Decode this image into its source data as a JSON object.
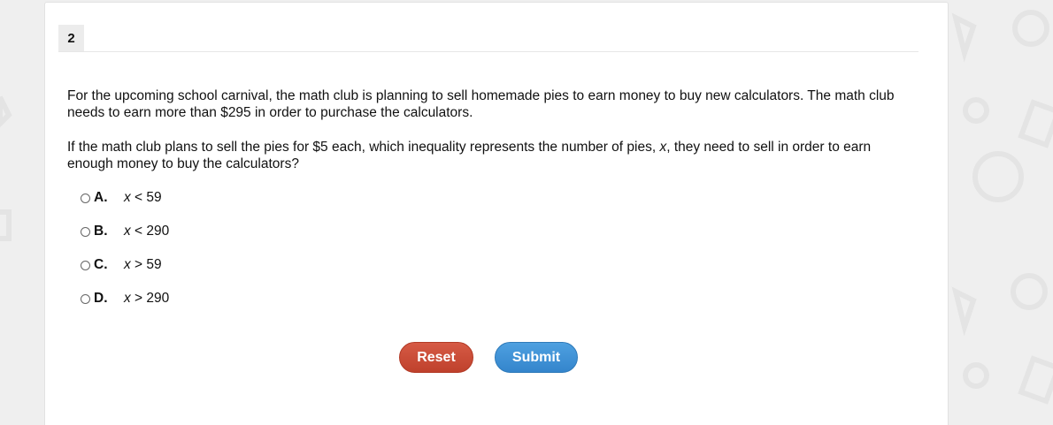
{
  "question": {
    "number": "2",
    "paragraph1": "For the upcoming school carnival, the math club is planning to sell homemade pies to earn money to buy new calculators. The math club needs to earn more than $295 in order to purchase the calculators.",
    "paragraph2_part1": "If the math club plans to sell the pies for $5 each, which inequality represents the number of pies, ",
    "paragraph2_var": "x",
    "paragraph2_part2": ", they need to sell in order to earn enough money to buy the calculators?",
    "options": [
      {
        "letter": "A.",
        "var": "x",
        "op": " < ",
        "value": "59"
      },
      {
        "letter": "B.",
        "var": "x",
        "op": " < ",
        "value": "290"
      },
      {
        "letter": "C.",
        "var": "x",
        "op": " > ",
        "value": "59"
      },
      {
        "letter": "D.",
        "var": "x",
        "op": " > ",
        "value": "290"
      }
    ]
  },
  "buttons": {
    "reset_label": "Reset",
    "submit_label": "Submit"
  },
  "colors": {
    "reset": "#c8493a",
    "submit": "#3d8fd6",
    "background": "#efefef"
  }
}
